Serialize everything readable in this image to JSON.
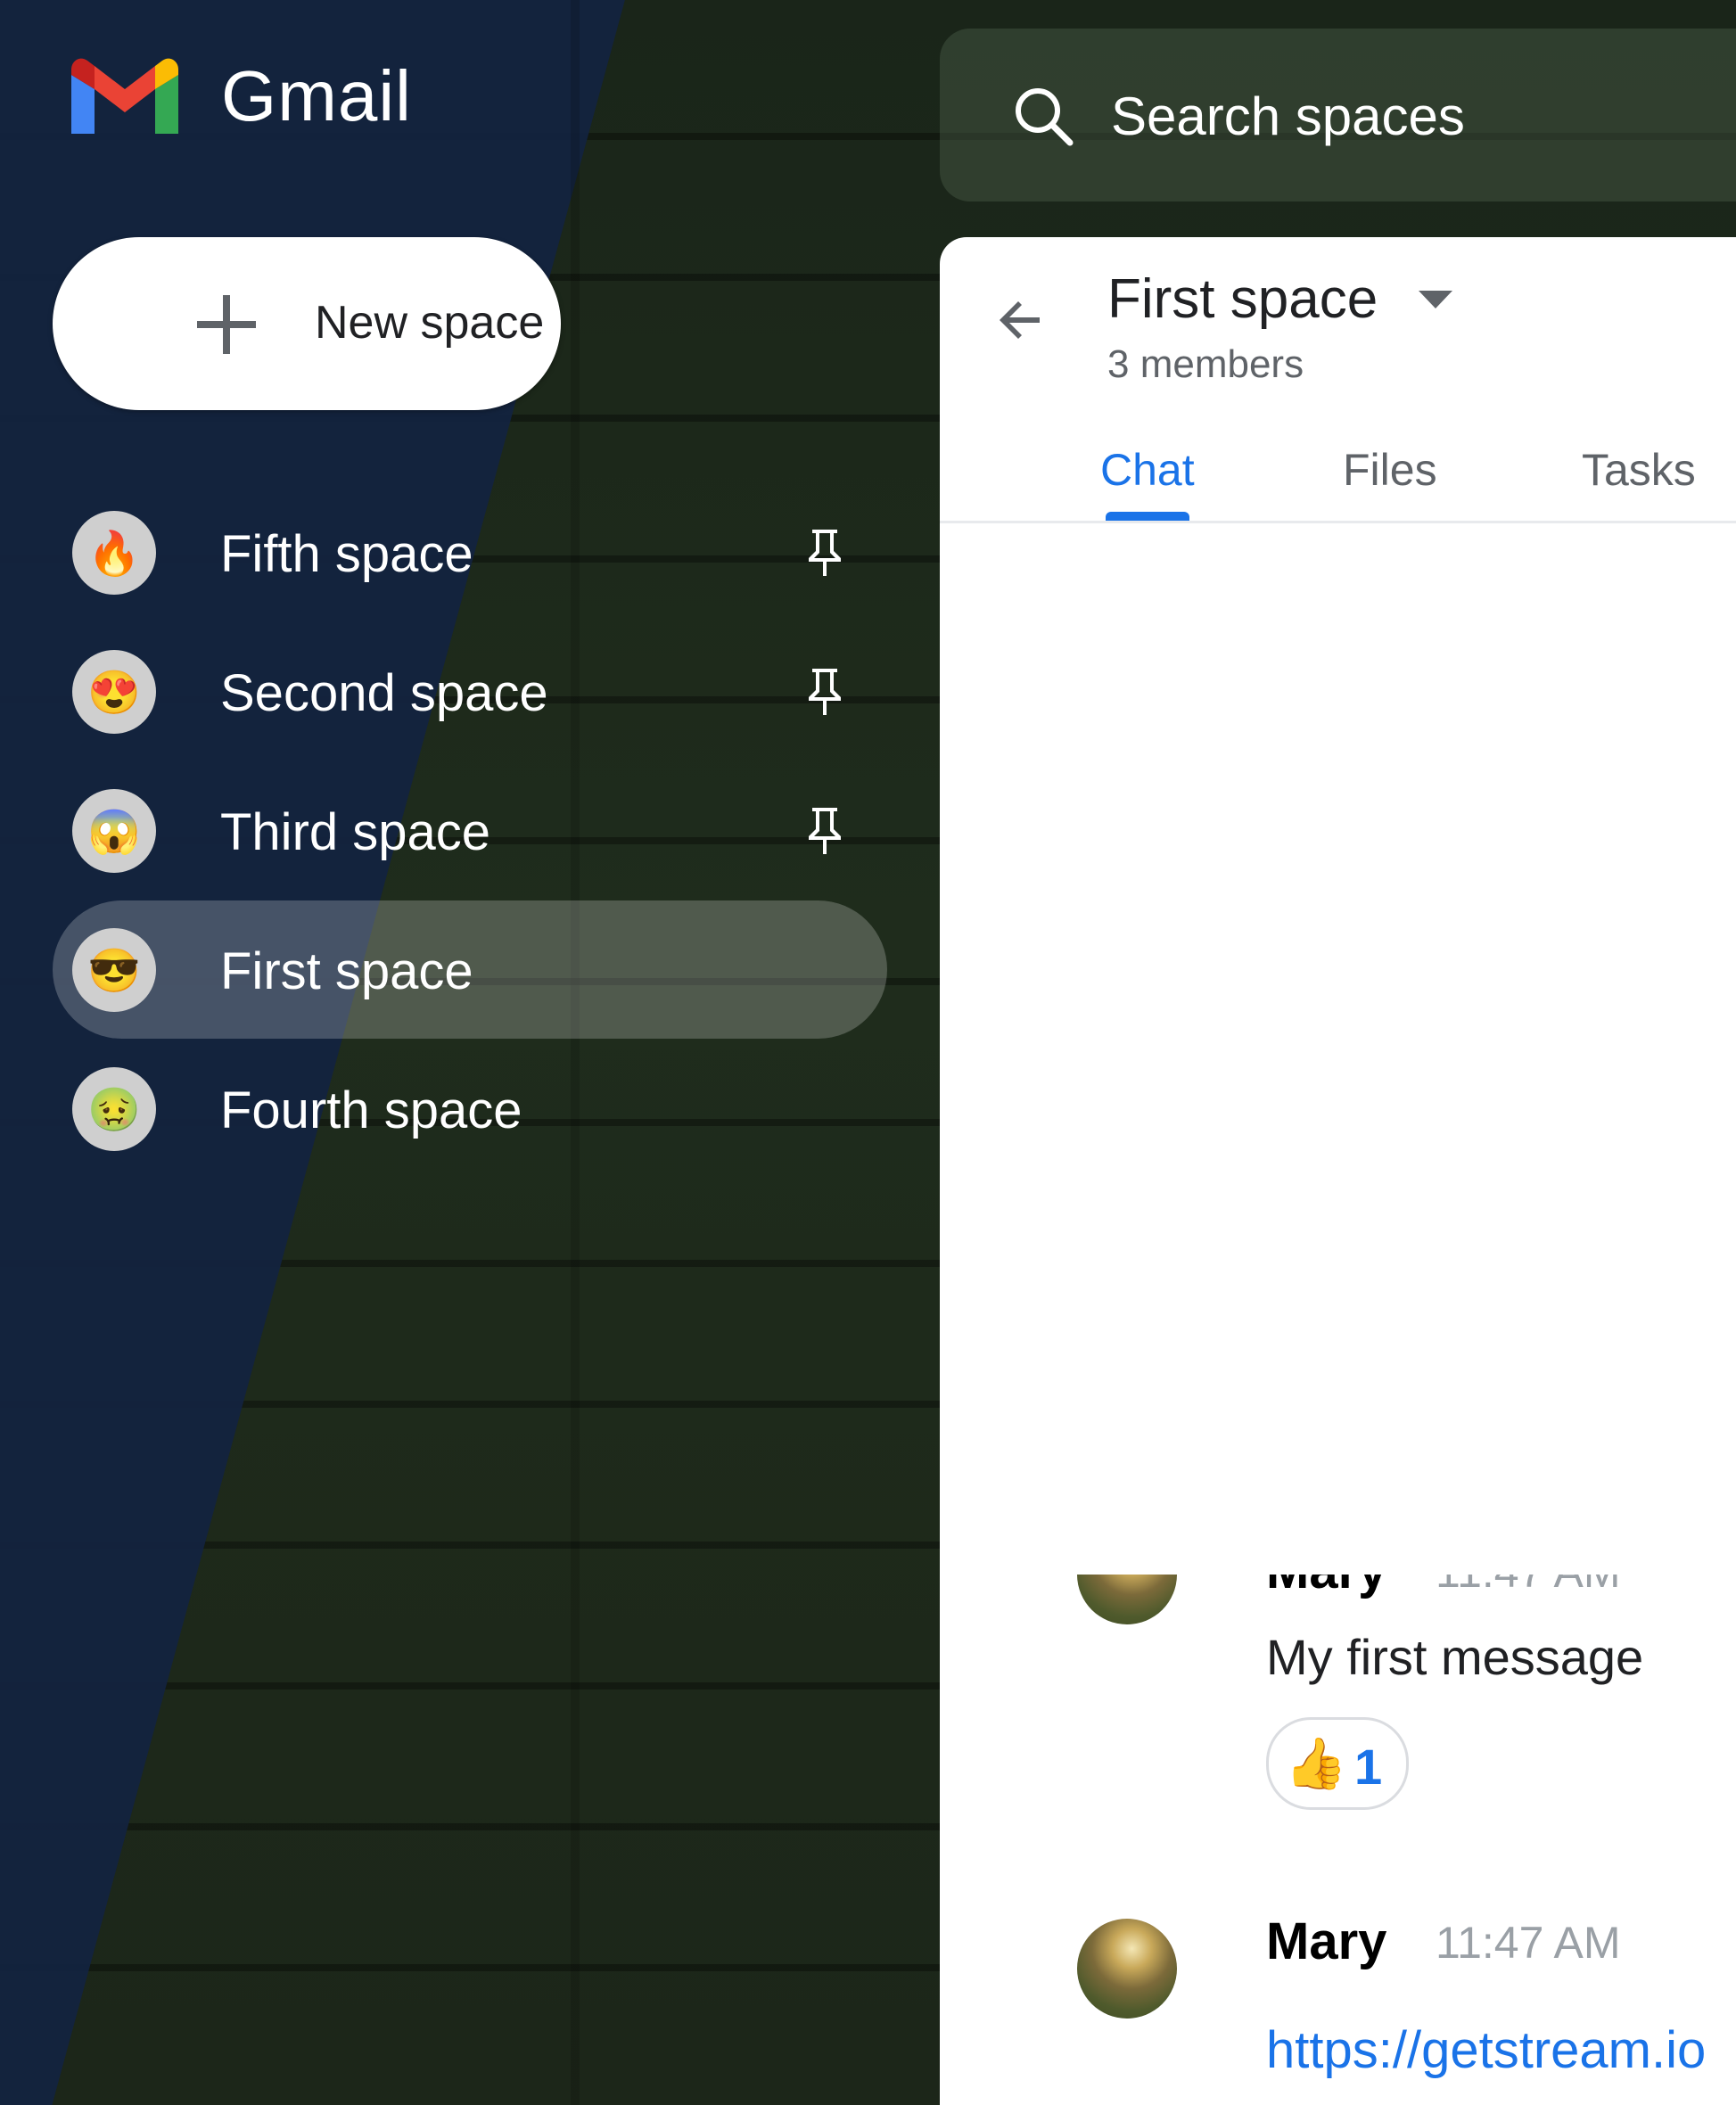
{
  "app": {
    "brand": "Gmail"
  },
  "sidebar": {
    "new_space_label": "New space",
    "spaces": [
      {
        "name": "Fifth space",
        "emoji": "🔥",
        "pinned": true,
        "active": false
      },
      {
        "name": "Second space",
        "emoji": "😍",
        "pinned": true,
        "active": false
      },
      {
        "name": "Third space",
        "emoji": "😱",
        "pinned": true,
        "active": false
      },
      {
        "name": "First space",
        "emoji": "😎",
        "pinned": false,
        "active": true
      },
      {
        "name": "Fourth space",
        "emoji": "🤢",
        "pinned": false,
        "active": false
      }
    ]
  },
  "search": {
    "placeholder": "Search spaces"
  },
  "chat": {
    "title": "First space",
    "members": "3 members",
    "tabs": [
      {
        "label": "Chat",
        "active": true
      },
      {
        "label": "Files",
        "active": false
      },
      {
        "label": "Tasks",
        "active": false
      }
    ],
    "messages": [
      {
        "sender": "Mary",
        "time": "11:47 AM",
        "text": "My first message",
        "reaction": {
          "emoji": "👍",
          "count": "1"
        }
      },
      {
        "sender": "Mary",
        "time": "11:47 AM",
        "link": "https://getstream.io"
      }
    ]
  },
  "colors": {
    "accent": "#1a73e8",
    "panel_bg": "#ffffff",
    "text_muted": "#5f6368"
  }
}
